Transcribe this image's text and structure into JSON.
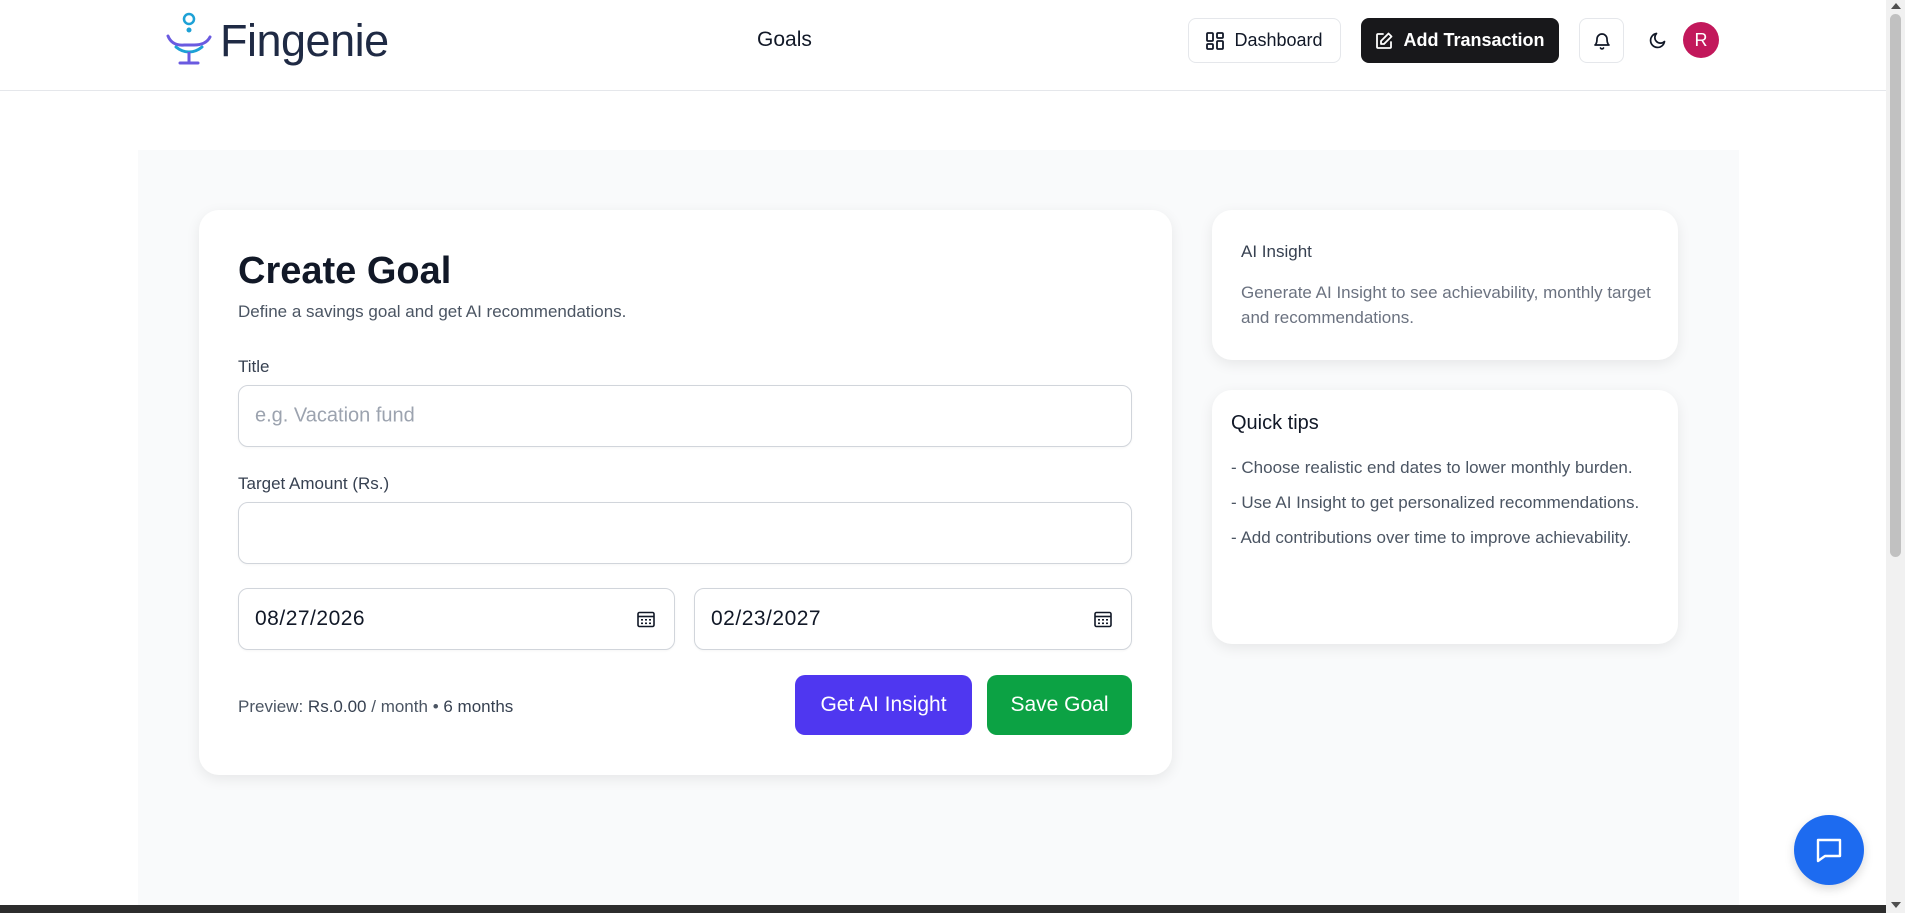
{
  "header": {
    "logo_text": "Fingenie",
    "nav_title": "Goals",
    "dashboard_label": "Dashboard",
    "add_transaction_label": "Add Transaction",
    "avatar_initial": "R",
    "icons": [
      "dashboard-grid-icon",
      "edit-icon",
      "bell-icon",
      "moon-icon"
    ]
  },
  "form": {
    "title": "Create Goal",
    "subtitle": "Define a savings goal and get AI recommendations.",
    "title_label": "Title",
    "title_placeholder": "e.g. Vacation fund",
    "title_value": "",
    "amount_label": "Target Amount (Rs.)",
    "amount_value": "",
    "start_date": "08/27/2026",
    "end_date": "02/23/2027",
    "preview_prefix": "Preview:",
    "preview_amount": "Rs.0.00",
    "preview_per": "/ month",
    "preview_sep": "•",
    "preview_months": "6 months",
    "ai_button": "Get AI Insight",
    "save_button": "Save Goal"
  },
  "ai_insight": {
    "title": "AI Insight",
    "body": "Generate AI Insight to see achievability, monthly target and recommendations."
  },
  "tips": {
    "title": "Quick tips",
    "items": [
      "- Choose realistic end dates to lower monthly burden.",
      "- Use AI Insight to get personalized recommendations.",
      "- Add contributions over time to improve achievability."
    ]
  },
  "colors": {
    "primary": "#4f37f0",
    "success": "#0ca244",
    "dark_button": "#18181b",
    "avatar": "#c2185b",
    "chat": "#1d6bf0"
  }
}
